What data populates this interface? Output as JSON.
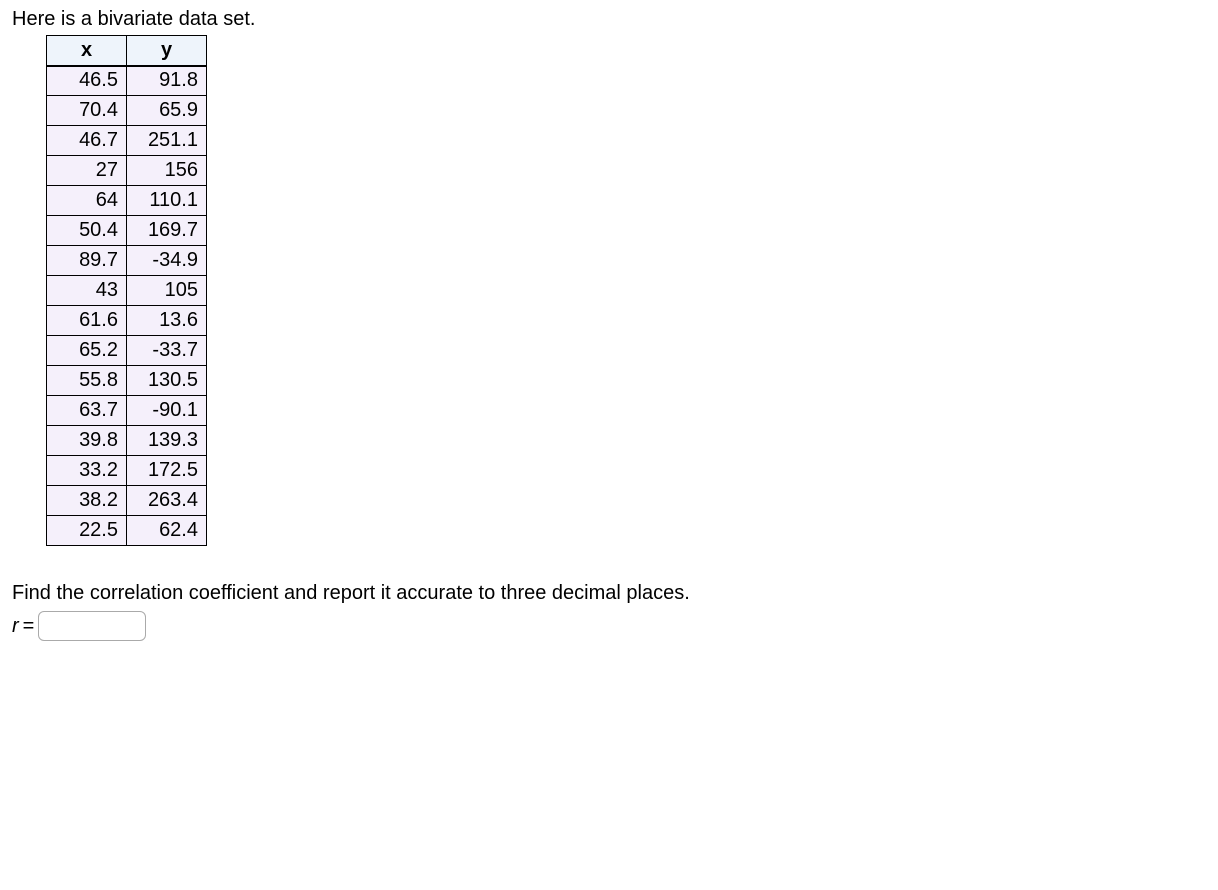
{
  "intro_text": "Here is a bivariate data set.",
  "table": {
    "headers": [
      "x",
      "y"
    ],
    "rows": [
      {
        "x": "46.5",
        "y": "91.8"
      },
      {
        "x": "70.4",
        "y": "65.9"
      },
      {
        "x": "46.7",
        "y": "251.1"
      },
      {
        "x": "27",
        "y": "156"
      },
      {
        "x": "64",
        "y": "110.1"
      },
      {
        "x": "50.4",
        "y": "169.7"
      },
      {
        "x": "89.7",
        "y": "-34.9"
      },
      {
        "x": "43",
        "y": "105"
      },
      {
        "x": "61.6",
        "y": "13.6"
      },
      {
        "x": "65.2",
        "y": "-33.7"
      },
      {
        "x": "55.8",
        "y": "130.5"
      },
      {
        "x": "63.7",
        "y": "-90.1"
      },
      {
        "x": "39.8",
        "y": "139.3"
      },
      {
        "x": "33.2",
        "y": "172.5"
      },
      {
        "x": "38.2",
        "y": "263.4"
      },
      {
        "x": "22.5",
        "y": "62.4"
      }
    ]
  },
  "question_text": "Find the correlation coefficient and report it accurate to three decimal places.",
  "answer": {
    "label_r": "r",
    "equals": " = ",
    "value": ""
  }
}
